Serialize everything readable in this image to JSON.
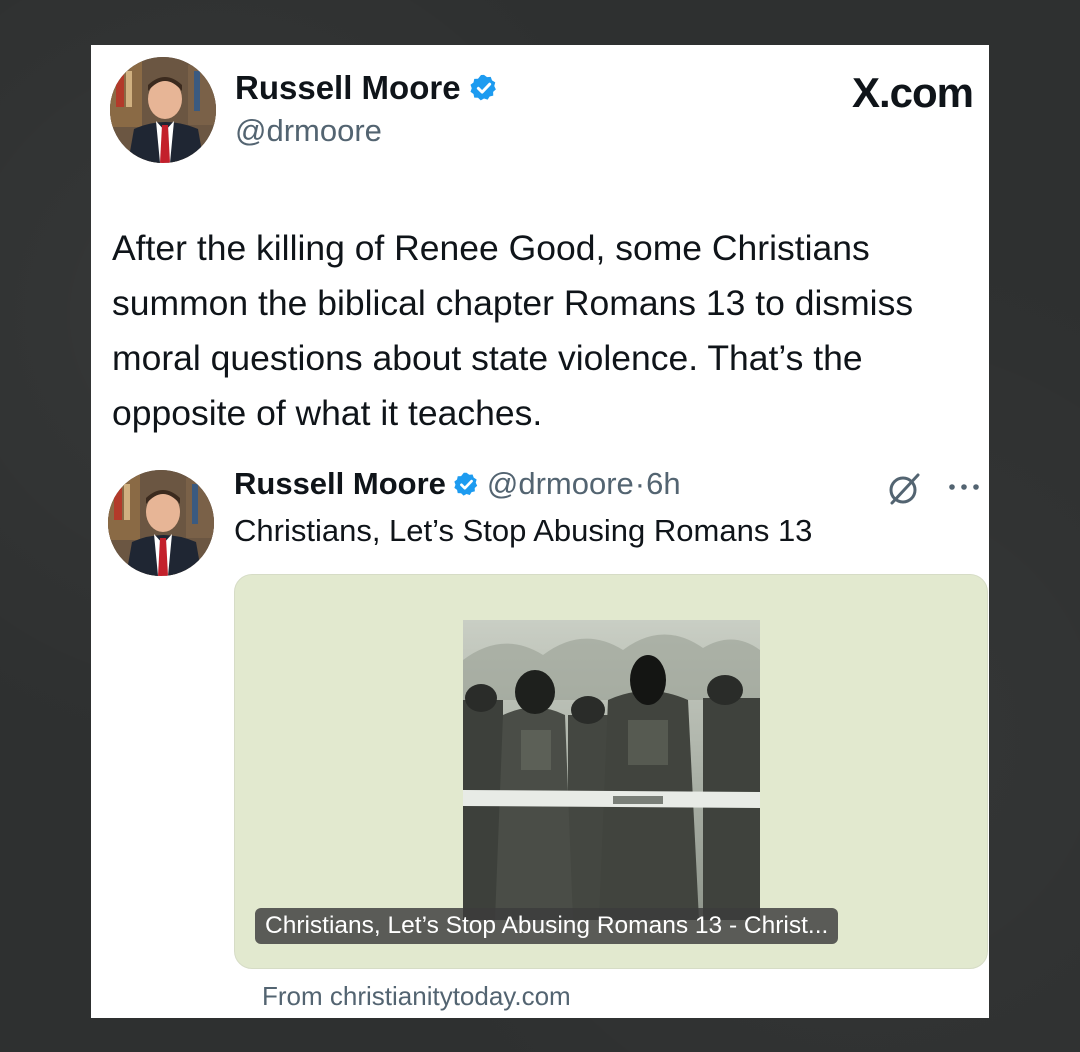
{
  "post": {
    "author_name": "Russell Moore",
    "author_handle": "@drmoore",
    "site_label": "X.com",
    "text": "After the killing of Renee Good, some Christians summon the biblical chapter Romans 13 to dismiss moral questions about state violence. That’s the opposite of what it teaches."
  },
  "quoted": {
    "author_name": "Russell Moore",
    "author_handle": "@drmoore",
    "separator": "·",
    "time": "6h",
    "text": "Christians, Let’s Stop Abusing Romans 13",
    "link_card": {
      "caption": "Christians, Let’s Stop Abusing Romans 13 - Christ...",
      "source": "From christianitytoday.com"
    }
  },
  "colors": {
    "verified_badge": "#1d9bf0",
    "link_card_bg": "#e2e9cf"
  },
  "icons": {
    "verified": "verified-badge-icon",
    "grok": "grok-icon",
    "more": "more-icon"
  }
}
